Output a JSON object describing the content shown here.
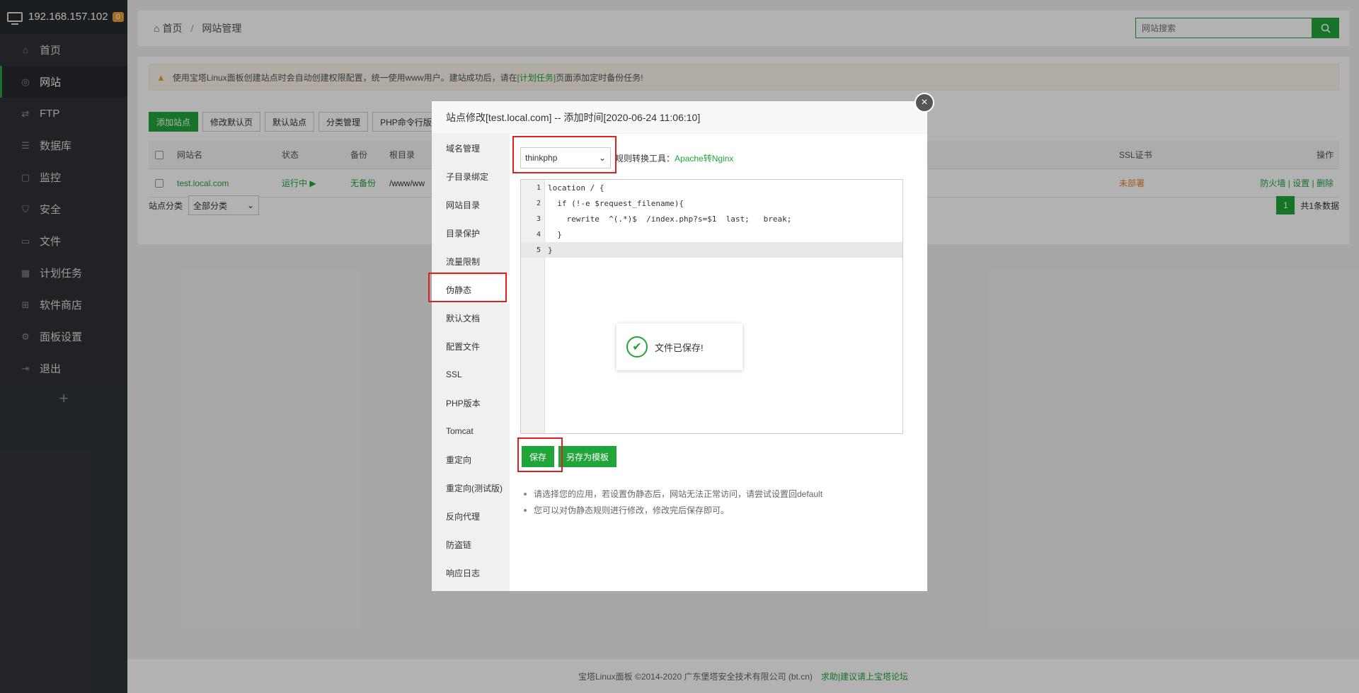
{
  "sidebar": {
    "ip": "192.168.157.102",
    "badge": "0",
    "items": [
      {
        "label": "首页",
        "icon": "home-icon"
      },
      {
        "label": "网站",
        "icon": "globe-icon"
      },
      {
        "label": "FTP",
        "icon": "ftp-icon"
      },
      {
        "label": "数据库",
        "icon": "database-icon"
      },
      {
        "label": "监控",
        "icon": "monitor-icon"
      },
      {
        "label": "安全",
        "icon": "shield-icon"
      },
      {
        "label": "文件",
        "icon": "folder-icon"
      },
      {
        "label": "计划任务",
        "icon": "calendar-icon"
      },
      {
        "label": "软件商店",
        "icon": "grid-icon"
      },
      {
        "label": "面板设置",
        "icon": "gear-icon"
      },
      {
        "label": "退出",
        "icon": "logout-icon"
      }
    ],
    "add": "+"
  },
  "header": {
    "breadcrumb_home": "首页",
    "breadcrumb_sep": "/",
    "breadcrumb_current": "网站管理",
    "search_placeholder": "网站搜索"
  },
  "notice": {
    "text_before": "使用宝塔Linux面板创建站点时会自动创建权限配置，统一使用www用户。建站成功后，请在",
    "link": "[计划任务]",
    "text_after": "页面添加定时备份任务!"
  },
  "toolbar": {
    "add_site": "添加站点",
    "edit_default_page": "修改默认页",
    "default_site": "默认站点",
    "category_manage": "分类管理",
    "php_cli": "PHP命令行版本"
  },
  "table": {
    "headers": {
      "site": "网站名",
      "state": "状态",
      "backup": "备份",
      "root": "根目录",
      "ssl": "SSL证书",
      "ops": "操作"
    },
    "rows": [
      {
        "site": "test.local.com",
        "state": "运行中 ▶",
        "backup": "无备份",
        "root": "/www/ww",
        "ssl": "未部署",
        "op_firewall": "防火墙",
        "op_settings": "设置",
        "op_delete": "删除",
        "op_sep": "|"
      }
    ]
  },
  "table_footer": {
    "category_label": "站点分类",
    "category_value": "全部分类",
    "page": "1",
    "total": "共1条数据"
  },
  "footer": {
    "copyright": "宝塔Linux面板 ©2014-2020 广东堡塔安全技术有限公司 (bt.cn)",
    "link": "求助|建议请上宝塔论坛"
  },
  "dialog": {
    "title": "站点修改[test.local.com] -- 添加时间[2020-06-24 11:06:10]",
    "close": "×",
    "nav": [
      "域名管理",
      "子目录绑定",
      "网站目录",
      "目录保护",
      "流量限制",
      "伪静态",
      "默认文档",
      "配置文件",
      "SSL",
      "PHP版本",
      "Tomcat",
      "重定向",
      "重定向(测试版)",
      "反向代理",
      "防盗链",
      "响应日志"
    ],
    "active_nav": 5,
    "rule_select": "thinkphp",
    "rule_tool_label": "规则转换工具：",
    "rule_tool_link": "Apache转Nginx",
    "code_lines": [
      {
        "n": "1",
        "text": "location / {"
      },
      {
        "n": "2",
        "text": "  if (!-e $request_filename){"
      },
      {
        "n": "3",
        "text": "    rewrite  ^(.*)$  /index.php?s=$1  last;   break;"
      },
      {
        "n": "4",
        "text": "  }"
      },
      {
        "n": "5",
        "text": "}"
      }
    ],
    "save": "保存",
    "save_as_template": "另存为模板",
    "tips": [
      "请选择您的应用，若设置伪静态后，网站无法正常访问，请尝试设置回default",
      "您可以对伪静态规则进行修改，修改完后保存即可。"
    ]
  },
  "toast": {
    "text": "文件已保存!"
  },
  "colors": {
    "accent": "#20a53a",
    "sidebar_bg": "#303439",
    "highlight": "#e02020"
  }
}
